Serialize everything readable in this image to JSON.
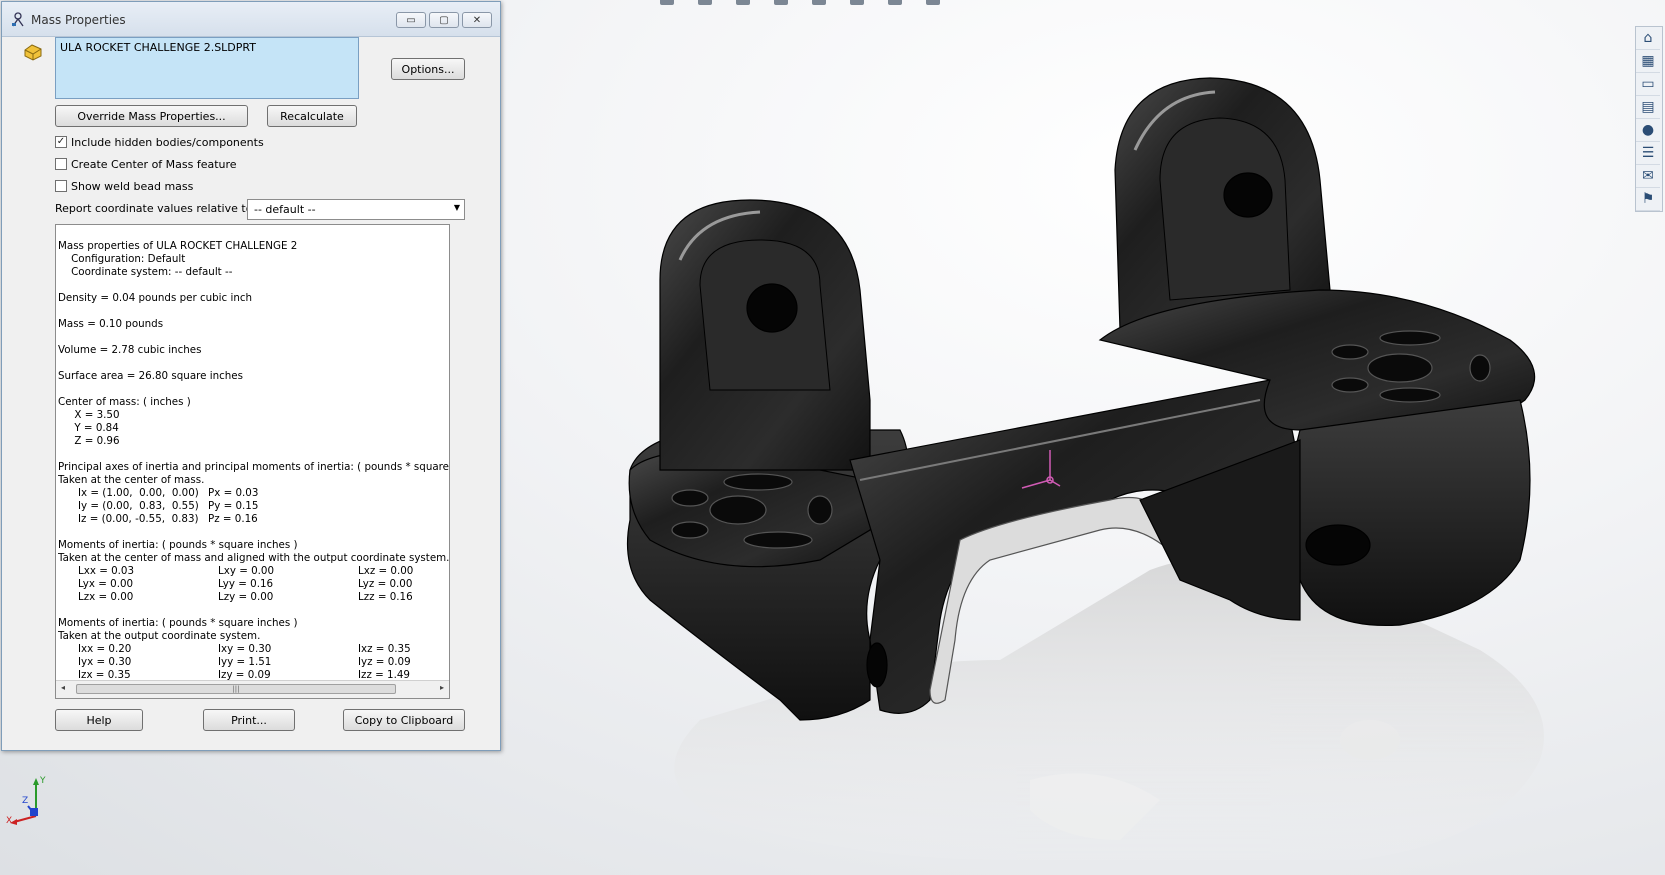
{
  "window": {
    "title": "Mass Properties",
    "buttons": {
      "minimize": "▭",
      "restore": "▢",
      "close": "✕"
    }
  },
  "selection": {
    "items": [
      "ULA ROCKET CHALLENGE 2.SLDPRT"
    ]
  },
  "buttons": {
    "options": "Options...",
    "override": "Override Mass Properties...",
    "recalculate": "Recalculate",
    "help": "Help",
    "print": "Print...",
    "copy": "Copy to Clipboard"
  },
  "checkboxes": [
    {
      "label": "Include hidden bodies/components",
      "checked": true
    },
    {
      "label": "Create Center of Mass feature",
      "checked": false
    },
    {
      "label": "Show weld bead mass",
      "checked": false
    }
  ],
  "coordinate": {
    "label": "Report coordinate values relative to:",
    "value": "-- default --"
  },
  "report": {
    "header": "Mass properties of ULA ROCKET CHALLENGE 2",
    "configuration": "    Configuration: Default",
    "coordinate_system": "    Coordinate system: -- default --",
    "density": "Density = 0.04 pounds per cubic inch",
    "mass": "Mass = 0.10 pounds",
    "volume": "Volume = 2.78 cubic inches",
    "surface_area": "Surface area = 26.80 square inches",
    "com_title": "Center of mass: ( inches )",
    "com_x": "     X = 3.50",
    "com_y": "     Y = 0.84",
    "com_z": "     Z = 0.96",
    "principal_title": "Principal axes of inertia and principal moments of inertia: ( pounds * square",
    "principal_sub": "Taken at the center of mass.",
    "principal_rows": [
      [
        "Ix = (1.00,  0.00,  0.00)",
        "Px = 0.03"
      ],
      [
        "Iy = (0.00,  0.83,  0.55)",
        "Py = 0.15"
      ],
      [
        "Iz = (0.00, -0.55,  0.83)",
        "Pz = 0.16"
      ]
    ],
    "moi_com_title": "Moments of inertia: ( pounds * square inches )",
    "moi_com_sub": "Taken at the center of mass and aligned with the output coordinate system.",
    "moi_com_rows": [
      [
        "Lxx = 0.03",
        "Lxy = 0.00",
        "Lxz = 0.00"
      ],
      [
        "Lyx = 0.00",
        "Lyy = 0.16",
        "Lyz = 0.00"
      ],
      [
        "Lzx = 0.00",
        "Lzy = 0.00",
        "Lzz = 0.16"
      ]
    ],
    "moi_out_title": "Moments of inertia: ( pounds * square inches )",
    "moi_out_sub": "Taken at the output coordinate system.",
    "moi_out_rows": [
      [
        "Ixx = 0.20",
        "Ixy = 0.30",
        "Ixz = 0.35"
      ],
      [
        "Iyx = 0.30",
        "Iyy = 1.51",
        "Iyz = 0.09"
      ],
      [
        "Izx = 0.35",
        "Izy = 0.09",
        "Izz = 1.49"
      ]
    ]
  },
  "scrollbar": {
    "left": "◂",
    "right": "▸",
    "grip": "|||"
  },
  "triad": {
    "x": "X",
    "y": "Y",
    "z": "Z"
  },
  "colors": {
    "model": "#1b1b1b",
    "selection_bg": "#c5e4f7",
    "axis_x": "#cc2222",
    "axis_y": "#2a9a2a",
    "axis_z": "#2244cc"
  },
  "right_toolbar_icons": [
    "home-icon",
    "3d-view-icon",
    "folder-icon",
    "design-library-icon",
    "appearance-icon",
    "properties-icon",
    "forum-icon",
    "view-palette-icon"
  ]
}
